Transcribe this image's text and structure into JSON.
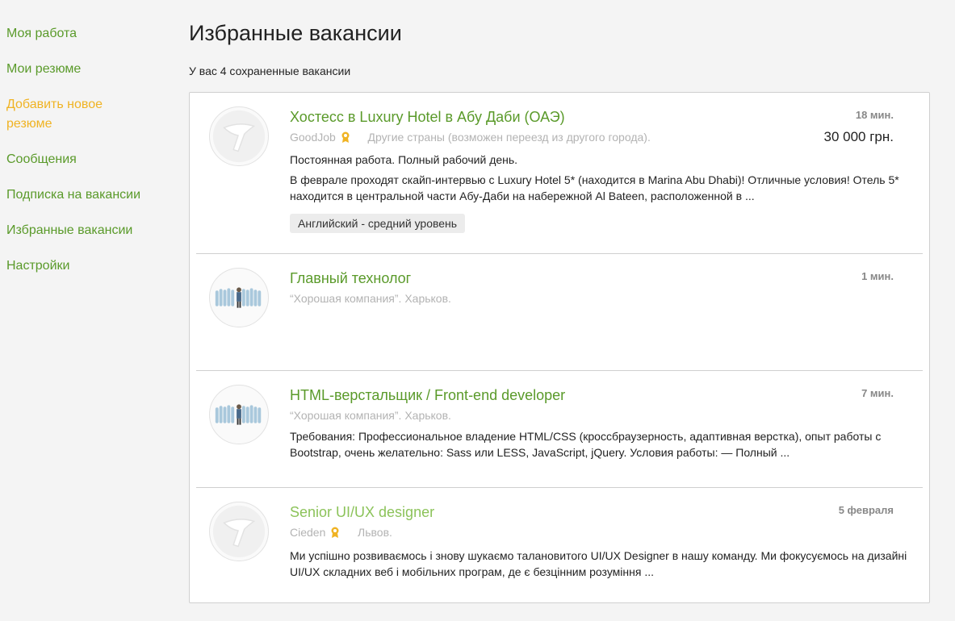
{
  "sidebar": {
    "items": [
      {
        "label": "Моя работа"
      },
      {
        "label": "Мои резюме"
      },
      {
        "label": "Добавить новое резюме"
      },
      {
        "label": "Сообщения"
      },
      {
        "label": "Подписка на вакансии"
      },
      {
        "label": "Избранные вакансии"
      },
      {
        "label": "Настройки"
      }
    ],
    "accent_color": "#f0b323",
    "link_color": "#5a9a2a"
  },
  "main": {
    "title": "Избранные вакансии",
    "saved_count": "У вас 4 сохраненные вакансии",
    "vacancies": [
      {
        "title": "Хостесс в Luxury Hotel в Абу Даби (ОАЭ)",
        "company": "GoodJob",
        "location": "Другие страны (возможен переезд из другого города).",
        "time": "18 мин.",
        "salary": "30 000 грн.",
        "employment": "Постоянная работа. Полный рабочий день.",
        "description": "В феврале проходят скайп-интервью с Luxury Hotel 5* (находится в Marina Abu Dhabi)! Отличные условия! Отель 5* находится в центральной части Абу-Даби на набережной Al Bateen, расположенной в ...",
        "tag": "Английский - средний уровень",
        "logo_icon": "placeholder-logo-icon"
      },
      {
        "title": "Главный технолог",
        "company_line": "“Хорошая компания”. Харьков.",
        "time": "1 мин.",
        "logo_icon": "crowd-logo-icon"
      },
      {
        "title": "HTML-верстальщик / Front-end developer",
        "company_line": "“Хорошая компания”. Харьков.",
        "time": "7 мин.",
        "description": "Требования: Профессиональное владение HTML/CSS (кроссбраузерность, адаптивная верстка), опыт работы с Bootstrap, очень желательно: Sass или LESS, JavaScript, jQuery. Условия работы: — Полный ...",
        "logo_icon": "crowd-logo-icon"
      },
      {
        "title": "Senior UI/UX designer",
        "company": "Cieden",
        "location": "Львов.",
        "time": "5 февраля",
        "description": "Ми успішно розвиваємось і знову шукаємо талановитого UI/UX Designer в нашу команду. Ми фокусуємось на дизайні UI/UX складних веб і мобільних програм, де є безцінним розуміння ...",
        "logo_icon": "placeholder-logo-icon"
      }
    ]
  }
}
